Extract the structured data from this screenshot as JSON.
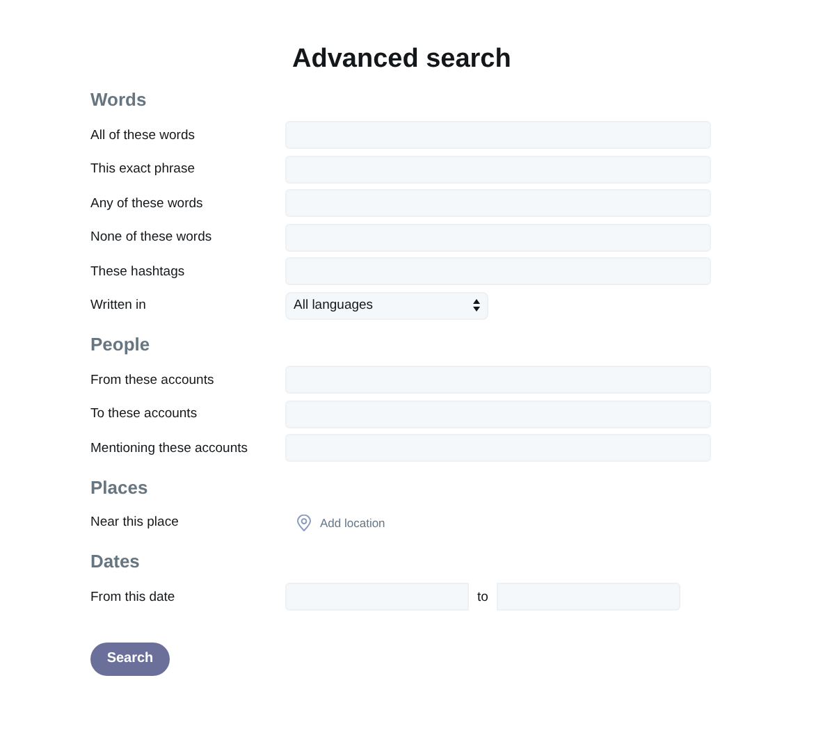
{
  "title": "Advanced search",
  "sections": [
    {
      "heading": "Words",
      "rows": [
        {
          "kind": "text",
          "label": "All of these words"
        },
        {
          "kind": "text",
          "label": "This exact phrase"
        },
        {
          "kind": "text",
          "label": "Any of these words"
        },
        {
          "kind": "text",
          "label": "None of these words"
        },
        {
          "kind": "text",
          "label": "These hashtags"
        },
        {
          "kind": "select",
          "label": "Written in",
          "value": "All languages"
        }
      ]
    },
    {
      "heading": "People",
      "rows": [
        {
          "kind": "text",
          "label": "From these accounts"
        },
        {
          "kind": "text",
          "label": "To these accounts"
        },
        {
          "kind": "text",
          "label": "Mentioning these accounts"
        }
      ]
    },
    {
      "heading": "Places",
      "rows": [
        {
          "kind": "location",
          "label": "Near this place",
          "link": "Add location"
        }
      ]
    },
    {
      "heading": "Dates",
      "rows": [
        {
          "kind": "daterange",
          "label": "From this date",
          "separator": "to"
        }
      ]
    }
  ],
  "button": "Search"
}
